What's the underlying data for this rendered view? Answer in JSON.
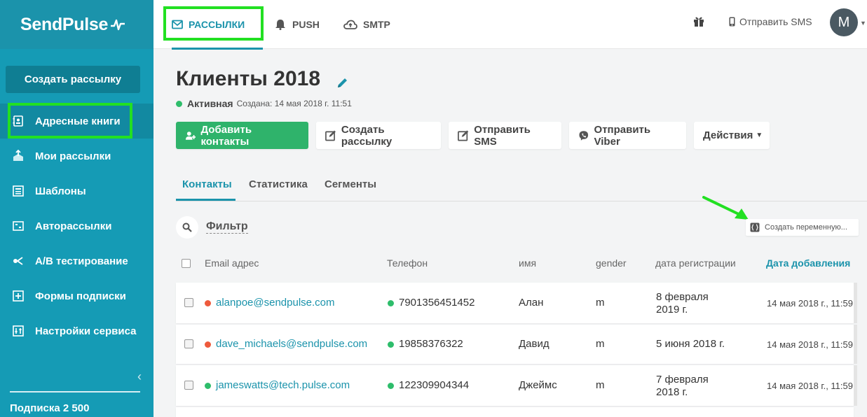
{
  "app": {
    "logo": "SendPulse"
  },
  "topbar": {
    "tabs": [
      {
        "label": "РАССЫЛКИ",
        "icon": "mail-icon"
      },
      {
        "label": "PUSH",
        "icon": "bell-icon"
      },
      {
        "label": "SMTP",
        "icon": "cloud-upload-icon"
      }
    ],
    "send_sms": "Отправить SMS",
    "avatar_letter": "M"
  },
  "sidebar": {
    "create_button": "Создать рассылку",
    "items": [
      {
        "label": "Адресные книги",
        "icon": "address-book-icon"
      },
      {
        "label": "Мои рассылки",
        "icon": "campaigns-icon"
      },
      {
        "label": "Шаблоны",
        "icon": "templates-icon"
      },
      {
        "label": "Авторассылки",
        "icon": "automation-icon"
      },
      {
        "label": "A/B тестирование",
        "icon": "ab-test-icon"
      },
      {
        "label": "Формы подписки",
        "icon": "forms-icon"
      },
      {
        "label": "Настройки сервиса",
        "icon": "settings-icon"
      }
    ],
    "subscription": "Подписка 2 500"
  },
  "main": {
    "title": "Клиенты 2018",
    "status": "Активная",
    "created": "Создана: 14 мая 2018 г. 11:51",
    "actions": {
      "add_contacts": "Добавить контакты",
      "create_campaign": "Создать рассылку",
      "send_sms": "Отправить SMS",
      "send_viber": "Отправить Viber",
      "more": "Действия"
    },
    "tabs": [
      "Контакты",
      "Статистика",
      "Сегменты"
    ],
    "filter": "Фильтр",
    "create_variable": "Создать переменную...",
    "columns": [
      "Email адрес",
      "Телефон",
      "имя",
      "gender",
      "дата регистрации",
      "Дата добавления"
    ],
    "rows": [
      {
        "email": "alanpoe@sendpulse.com",
        "email_status": "#ee5a3c",
        "phone": "7901356451452",
        "name": "Алан",
        "gender": "m",
        "registered": "8 февраля\n2019 г.",
        "added": "14 мая 2018 г., 11:59"
      },
      {
        "email": "dave_michaels@sendpulse.com",
        "email_status": "#ee5a3c",
        "phone": "19858376322",
        "name": "Давид",
        "gender": "m",
        "registered": "5 июня 2018 г.",
        "added": "14 мая 2018 г., 11:59"
      },
      {
        "email": "jameswatts@tech.pulse.com",
        "email_status": "#2ebd6b",
        "phone": "122309904344",
        "name": "Джеймс",
        "gender": "m",
        "registered": "7 февраля\n2018 г.",
        "added": "14 мая 2018 г., 11:59"
      }
    ]
  },
  "colors": {
    "brand": "#159bb5",
    "accent": "#1b93ab",
    "green": "#2fb36b",
    "highlight": "#22e022"
  }
}
